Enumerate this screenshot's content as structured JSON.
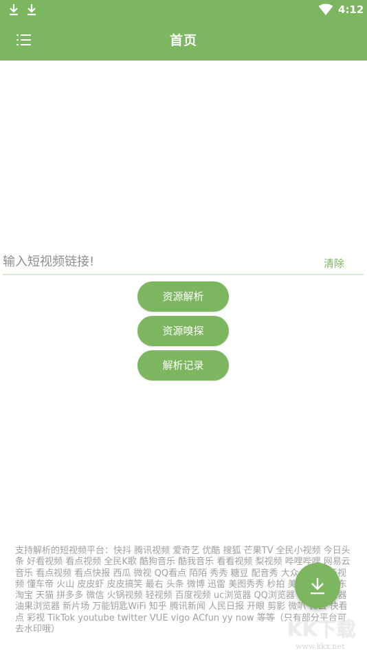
{
  "status_bar": {
    "time": "4:12"
  },
  "app_bar": {
    "title": "首页"
  },
  "input": {
    "placeholder": "输入短视频链接!",
    "clear_label": "清除"
  },
  "buttons": {
    "parse": "资源解析",
    "sniff": "资源嗅探",
    "history": "解析记录"
  },
  "support_text": "支持解析的短视频平台：快抖 腾讯视频 爱奇艺 优酷 搜狐 芒果TV 全民小视频 今日头条 好看视频 看点视频 全民K歌 酷狗音乐 酷我音乐 看看视频 梨视频 哔哩哔哩 网易云音乐 看点视频 看点快报 西瓜 微视 QQ看点 陌陌 秀秀 糖豆 配音秀 大众点评 虎牙视频 懂车帝 火山 皮皮虾 皮皮搞笑 最右 头条 微博 迅雷 美图秀秀 秒拍 美拍 刷宝 京东 淘宝 天猫 拼多多 微信 火锅视频 轻视频 百度视频 uc浏览器 QQ浏览器 oppo浏览器 油果浏览器 新片场 万能钥匙WiFi 知乎 腾讯新闻 人民日报 开眼 剪影 微叭 微云 快看点 彩视 TikTok youtube twitter VUE vigo ACfun yy now 等等（只有部分平台可去水印哦）",
  "watermark": {
    "logo": "KK下载",
    "site": "www.kkx.net"
  },
  "colors": {
    "accent": "#7cb65f",
    "divider": "#dcebcf",
    "muted_text": "#a0a0a0"
  },
  "icons": {
    "status_left": [
      "download-icon",
      "download-icon"
    ],
    "status_right": [
      "wifi-icon"
    ],
    "menu": "menu-list-icon",
    "fab": "download-icon"
  }
}
